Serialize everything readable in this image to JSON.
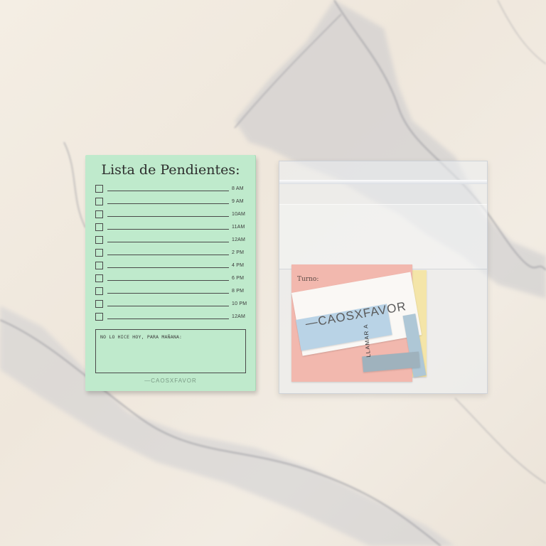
{
  "notepad": {
    "title": "Lista de Pendientes:",
    "times": [
      "8 AM",
      "9 AM",
      "10AM",
      "11AM",
      "12AM",
      "2 PM",
      "4 PM",
      "6 PM",
      "8 PM",
      "10 PM",
      "12AM"
    ],
    "note_label": "NO LO HICE HOY, PARA MAÑANA:",
    "brand": "—CAOSXFAVOR"
  },
  "bag": {
    "card_label": "Turno:",
    "brand": "—CAOSXFAVOR",
    "strip_label": "LLAMAR A"
  },
  "colors": {
    "notepad": "#bfeacc",
    "marble_bg": "#f2ece3",
    "pink_card": "#f2b8ae",
    "blue_card": "#b9d3e6"
  }
}
